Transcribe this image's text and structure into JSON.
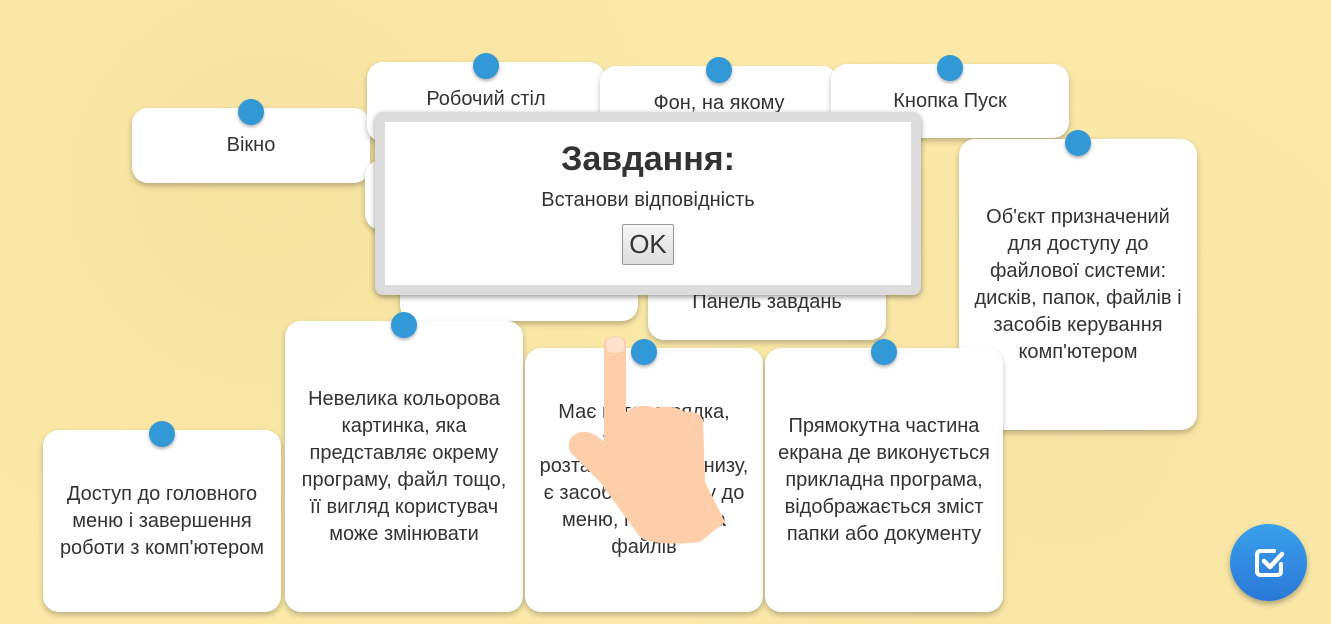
{
  "cards": [
    {
      "text": "Вікно"
    },
    {
      "text": "Робочий стіл"
    },
    {
      "text": "Фон, на якому"
    },
    {
      "text": "Кнопка Пуск"
    },
    {
      "text": ""
    },
    {
      "text": ""
    },
    {
      "text": "Панель завдань"
    },
    {
      "text": "Об'єкт призначений для доступу до файлової системи: дисків, папок, файлів і засобів керування комп'ютером"
    },
    {
      "text": "Доступ до головного меню і завершення роботи з комп'ютером"
    },
    {
      "text": "Невелика кольорова картинка, яка представляє окрему програму, файл тощо, її вигляд користувач може змінювати"
    },
    {
      "text": "Має вигляд рядка, зазвичай розташовується знизу, є засобом доступу до меню, програм та файлів"
    },
    {
      "text": "Прямокутна частина екрана де виконується прикладна програма, відображається зміст папки або документу"
    }
  ],
  "dialog": {
    "title": "Завдання:",
    "message": "Встанови відповідність",
    "ok_label": "OK"
  },
  "colors": {
    "pin": "#3398d6",
    "background": "#fbeaa9",
    "check_button": "#2f8ae0"
  }
}
